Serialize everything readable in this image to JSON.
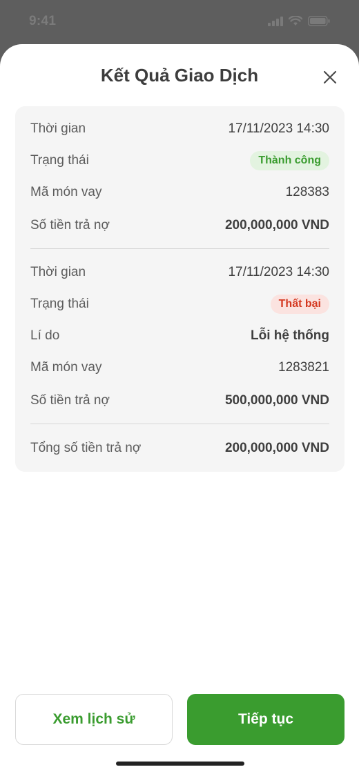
{
  "status_bar": {
    "time": "9:41"
  },
  "sheet": {
    "title": "Kết Quả Giao Dịch"
  },
  "transactions": [
    {
      "time_label": "Thời gian",
      "time_value": "17/11/2023 14:30",
      "status_label": "Trạng thái",
      "status_value": "Thành công",
      "loan_label": "Mã món vay",
      "loan_value": "128383",
      "amount_label": "Số tiền trả nợ",
      "amount_value": "200,000,000 VND"
    },
    {
      "time_label": "Thời gian",
      "time_value": "17/11/2023 14:30",
      "status_label": "Trạng thái",
      "status_value": "Thất bại",
      "reason_label": "Lí do",
      "reason_value": "Lỗi hệ thống",
      "loan_label": "Mã món vay",
      "loan_value": "1283821",
      "amount_label": "Số tiền trả nợ",
      "amount_value": "500,000,000 VND"
    }
  ],
  "total": {
    "label": "Tổng số tiền trả nợ",
    "value": "200,000,000 VND"
  },
  "buttons": {
    "history": "Xem lịch sử",
    "continue": "Tiếp tục"
  },
  "colors": {
    "primary_green": "#3a9c2f",
    "success_bg": "#e3f3e0",
    "fail_red": "#d4371f",
    "fail_bg": "#fbe3e0"
  }
}
